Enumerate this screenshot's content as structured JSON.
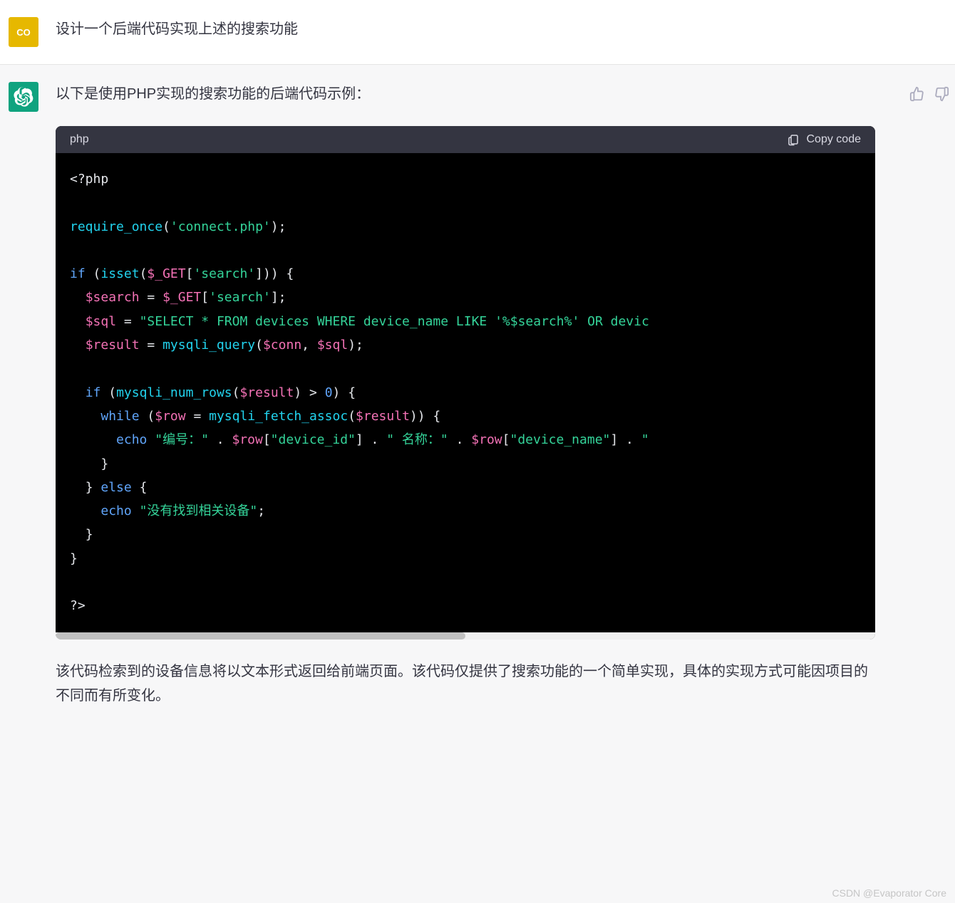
{
  "user": {
    "avatar_label": "CO",
    "message": "设计一个后端代码实现上述的搜索功能"
  },
  "assistant": {
    "intro": "以下是使用PHP实现的搜索功能的后端代码示例：",
    "code_lang": "php",
    "copy_label": "Copy code",
    "code": {
      "open_tag": "<?php",
      "require": {
        "fn": "require_once",
        "arg": "'connect.php'"
      },
      "if1": "if",
      "isset": "isset",
      "get": "$_GET",
      "search_key": "'search'",
      "search_var": "$search",
      "sql_var": "$sql",
      "sql_str": "\"SELECT * FROM devices WHERE device_name LIKE '%$search%' OR devic",
      "result_var": "$result",
      "mysqli_query": "mysqli_query",
      "conn_var": "$conn",
      "mysqli_num_rows": "mysqli_num_rows",
      "gt_zero": "0",
      "while": "while",
      "row_var": "$row",
      "mysqli_fetch_assoc": "mysqli_fetch_assoc",
      "echo": "echo",
      "str_id_label": "\"编号：\"",
      "field_id": "\"device_id\"",
      "str_name_label": "\" 名称：\"",
      "field_name": "\"device_name\"",
      "str_tail": "\"",
      "else": "else",
      "not_found": "\"没有找到相关设备\"",
      "close_tag": "?>"
    },
    "outro": "该代码检索到的设备信息将以文本形式返回给前端页面。该代码仅提供了搜索功能的一个简单实现，具体的实现方式可能因项目的不同而有所变化。"
  },
  "watermark": "CSDN @Evaporator Core"
}
